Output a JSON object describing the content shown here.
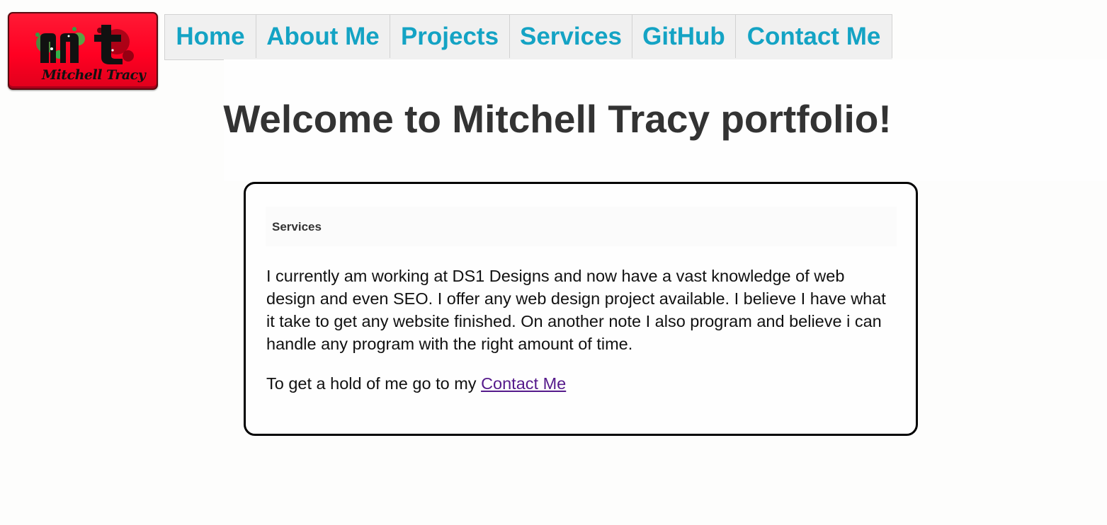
{
  "logo": {
    "monogram": "mt",
    "name": "Mitchell Tracy",
    "background_color": "#ff0022"
  },
  "nav": {
    "items": [
      {
        "label": "Home"
      },
      {
        "label": "About Me"
      },
      {
        "label": "Projects"
      },
      {
        "label": "Services"
      },
      {
        "label": "GitHub"
      },
      {
        "label": "Contact Me"
      }
    ],
    "link_color": "#14a3c4",
    "background_color": "#f0f0f0"
  },
  "page": {
    "title": "Welcome to Mitchell Tracy portfolio!"
  },
  "services": {
    "heading": "Services",
    "paragraph": "I currently am working at DS1 Designs and now have a vast knowledge of web design and even SEO. I offer any web design project available. I believe I have what it take to get any website finished. On another note I also program and believe i can handle any program with the right amount of time.",
    "contact_prefix": "To get a hold of me go to my ",
    "contact_link": "Contact Me",
    "link_color": "#551a8b"
  }
}
